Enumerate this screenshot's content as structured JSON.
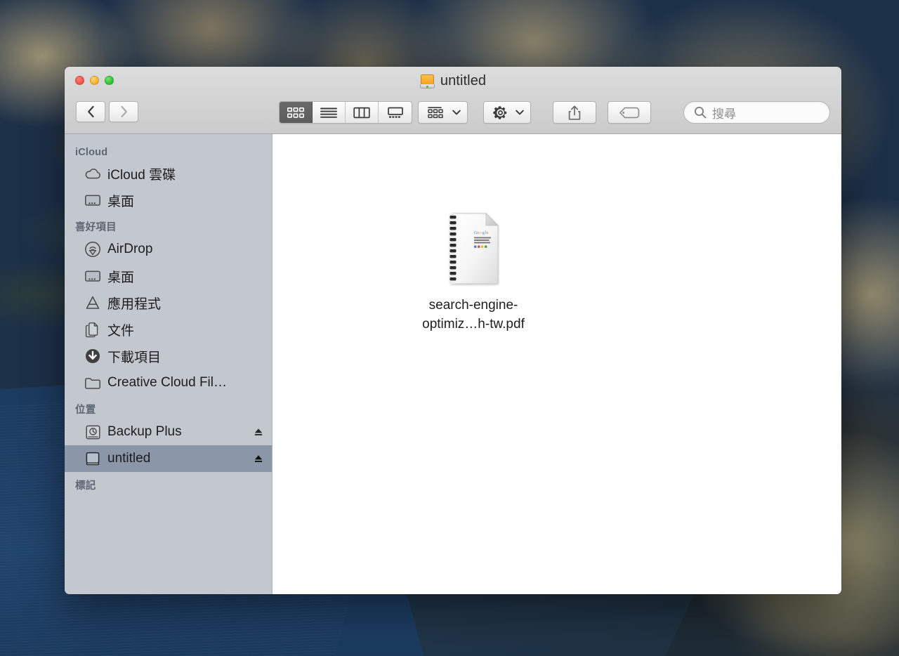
{
  "window": {
    "title": "untitled",
    "title_icon": "external-drive-icon"
  },
  "traffic_lights": {
    "close_label": "",
    "minimize_label": "",
    "zoom_label": "",
    "close_color": "#f44f43",
    "minimize_color": "#f6b01f",
    "zoom_color": "#27c22c"
  },
  "toolbar": {
    "back_icon": "chevron-left-icon",
    "forward_icon": "chevron-right-icon",
    "view_modes": [
      {
        "name": "icon-view",
        "icon": "grid-icon",
        "active": true
      },
      {
        "name": "list-view",
        "icon": "list-icon",
        "active": false
      },
      {
        "name": "column-view",
        "icon": "columns-icon",
        "active": false
      },
      {
        "name": "gallery-view",
        "icon": "coverflow-icon",
        "active": false
      }
    ],
    "arrange": {
      "icon": "arrange-grid-icon",
      "chevron": "chevron-down-icon"
    },
    "action": {
      "icon": "gear-icon",
      "chevron": "chevron-down-icon"
    },
    "share": {
      "icon": "share-icon"
    },
    "tags": {
      "icon": "tag-icon"
    }
  },
  "search": {
    "icon": "search-icon",
    "placeholder": "搜尋",
    "value": ""
  },
  "sidebar": {
    "sections": [
      {
        "header": "iCloud",
        "items": [
          {
            "label": "iCloud 雲碟",
            "icon": "cloud-icon",
            "eject": false,
            "selected": false
          },
          {
            "label": "桌面",
            "icon": "desktop-icon",
            "eject": false,
            "selected": false
          }
        ]
      },
      {
        "header": "喜好項目",
        "items": [
          {
            "label": "AirDrop",
            "icon": "airdrop-icon",
            "eject": false,
            "selected": false
          },
          {
            "label": "桌面",
            "icon": "desktop-icon",
            "eject": false,
            "selected": false
          },
          {
            "label": "應用程式",
            "icon": "applications-icon",
            "eject": false,
            "selected": false
          },
          {
            "label": "文件",
            "icon": "documents-icon",
            "eject": false,
            "selected": false
          },
          {
            "label": "下載項目",
            "icon": "downloads-icon",
            "eject": false,
            "selected": false
          },
          {
            "label": "Creative Cloud Fil…",
            "icon": "folder-icon",
            "eject": false,
            "selected": false
          }
        ]
      },
      {
        "header": "位置",
        "items": [
          {
            "label": "Backup Plus",
            "icon": "time-machine-drive-icon",
            "eject": true,
            "selected": false
          },
          {
            "label": "untitled",
            "icon": "external-drive-icon",
            "eject": true,
            "selected": true
          }
        ]
      },
      {
        "header": "標記",
        "items": []
      }
    ]
  },
  "content": {
    "files": [
      {
        "name": "search-engine-optimiz…h-tw.pdf",
        "icon": "pdf-document-icon",
        "preview_brand": "Google"
      }
    ]
  }
}
